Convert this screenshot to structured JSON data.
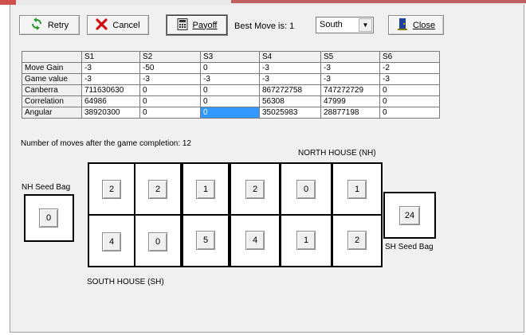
{
  "toolbar": {
    "retry_label": "Retry",
    "cancel_label": "Cancel",
    "payoff_label": "Payoff",
    "close_label": "Close",
    "best_move_text": "Best Move is: 1",
    "side_select_value": "South"
  },
  "table": {
    "headers": [
      "",
      "S1",
      "S2",
      "S3",
      "S4",
      "S5",
      "S6"
    ],
    "rows": [
      {
        "label": "Move Gain",
        "values": [
          "-3",
          "-50",
          "0",
          "-3",
          "-3",
          "-2"
        ]
      },
      {
        "label": "Game value",
        "values": [
          "-3",
          "-3",
          "-3",
          "-3",
          "-3",
          "-3"
        ]
      },
      {
        "label": "Canberra",
        "values": [
          "711630630",
          "0",
          "0",
          "867272758",
          "747272729",
          "0"
        ]
      },
      {
        "label": "Correlation",
        "values": [
          "64986",
          "0",
          "0",
          "56308",
          "47999",
          "0"
        ]
      },
      {
        "label": "Angular",
        "values": [
          "38920300",
          "0",
          "0",
          "35025983",
          "28877198",
          "0"
        ]
      }
    ]
  },
  "moves_after_text": "Number of moves after the game completion: 12",
  "board": {
    "north_house_label": "NORTH HOUSE (NH)",
    "south_house_label": "SOUTH HOUSE (SH)",
    "nh_seed_bag_label": "NH Seed Bag",
    "sh_seed_bag_label": "SH Seed Bag",
    "north_pits": [
      "2",
      "2",
      "1",
      "2",
      "0",
      "1"
    ],
    "south_pits": [
      "4",
      "0",
      "5",
      "4",
      "1",
      "2"
    ],
    "nh_seed_bag_value": "0",
    "sh_seed_bag_value": "24"
  },
  "colors": {
    "selection": "#3399ff",
    "retry_icon": "#2a9a2a",
    "cancel_icon": "#d01010",
    "close_icon": "#2040a0"
  },
  "icons": {
    "retry": "refresh-icon",
    "cancel": "x-icon",
    "payoff": "calculator-icon",
    "close": "door-icon"
  }
}
